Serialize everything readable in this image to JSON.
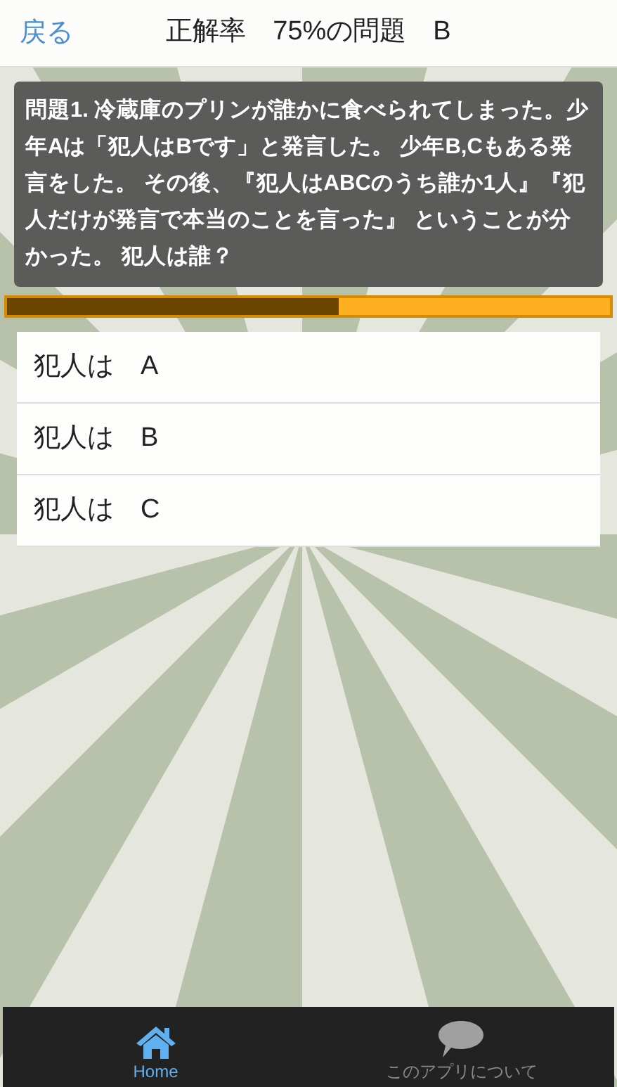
{
  "header": {
    "back": "戻る",
    "title": "正解率　75%の問題　B"
  },
  "question": "問題1. 冷蔵庫のプリンが誰かに食べられてしまった。少年Aは「犯人はBです」と発言した。 少年B,Cもある発言をした。 その後、『犯人はABCのうち誰か1人』『犯人だけが発言で本当のことを言った』 ということが分かった。 犯人は誰？",
  "progress": {
    "level": 0.55
  },
  "answers": [
    {
      "label": "犯人は　A"
    },
    {
      "label": "犯人は　B"
    },
    {
      "label": "犯人は　C"
    }
  ],
  "nav": [
    {
      "label": "Home",
      "kind": "home",
      "selected": true
    },
    {
      "label": "このアプリについて",
      "kind": "chat",
      "selected": false
    }
  ]
}
